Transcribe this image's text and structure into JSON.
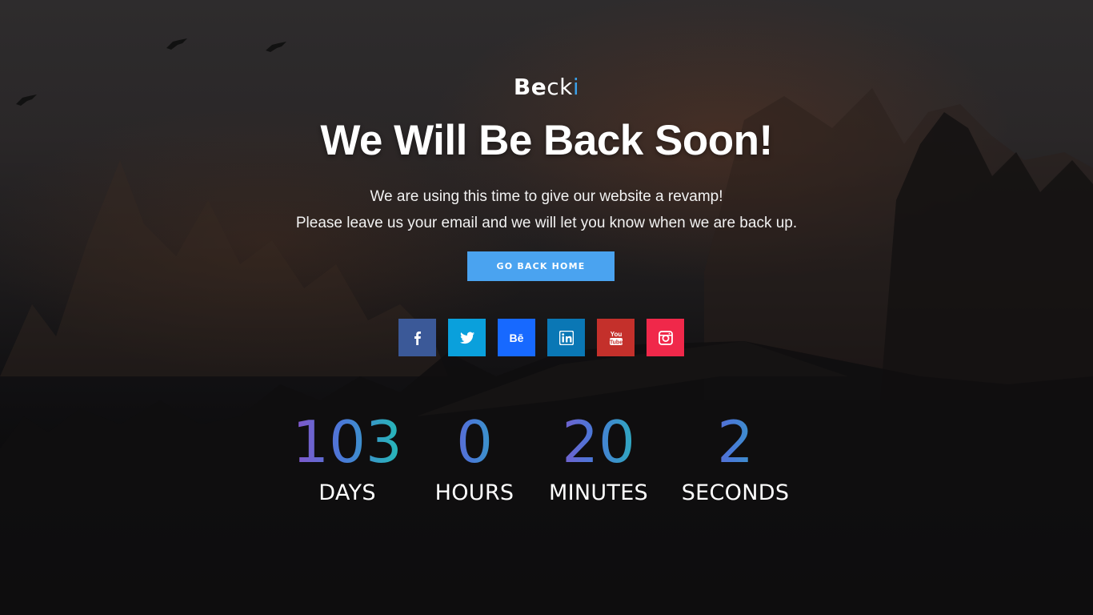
{
  "logo": {
    "first": "Be",
    "mid": "ck",
    "accent": "i"
  },
  "hero": {
    "title": "We Will Be Back Soon!",
    "line1": "We are using this time to give our website a revamp!",
    "line2": "Please leave us your email and we will let you know when we are back up."
  },
  "button": {
    "label": "GO BACK HOME"
  },
  "social": [
    {
      "icon": "facebook-icon",
      "glyph": "f",
      "color": "#3b5998"
    },
    {
      "icon": "twitter-icon",
      "glyph": "t",
      "color": "#0aa0dc"
    },
    {
      "icon": "behance-icon",
      "glyph": "Bē",
      "color": "#1769ff"
    },
    {
      "icon": "linkedin-icon",
      "glyph": "in",
      "color": "#0a77b5"
    },
    {
      "icon": "youtube-icon",
      "glyph": "You Tube",
      "color": "#c4302b"
    },
    {
      "icon": "instagram-icon",
      "glyph": "camera",
      "color": "#f0284a"
    }
  ],
  "countdown": {
    "days": "103",
    "days_label": "DAYS",
    "hours": "0",
    "hours_label": "HOURS",
    "minutes": "20",
    "minutes_label": "MINUTES",
    "seconds": "2",
    "seconds_label": "SECONDS"
  },
  "colors": {
    "accent": "#4aa3f0",
    "gradient_start": "#8a52c8",
    "gradient_end": "#22c0b4"
  }
}
